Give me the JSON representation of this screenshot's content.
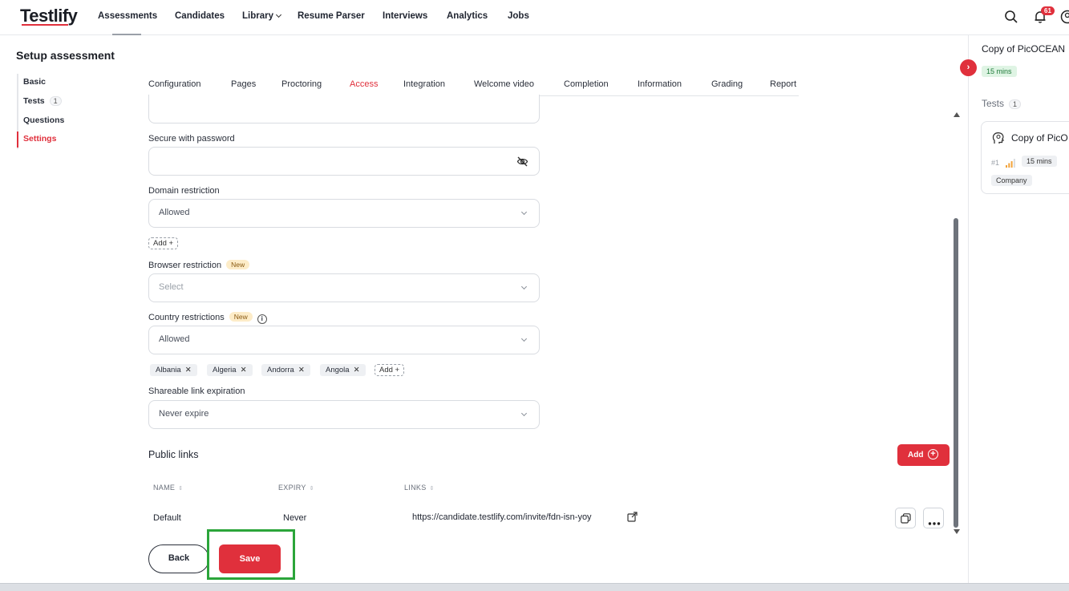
{
  "app": {
    "logo": "Testlify",
    "nav": [
      "Assessments",
      "Candidates",
      "Library",
      "Resume Parser",
      "Interviews",
      "Analytics",
      "Jobs"
    ],
    "notification_count": "61"
  },
  "sidebar": {
    "title": "Setup assessment",
    "items": [
      {
        "label": "Basic"
      },
      {
        "label": "Tests",
        "count": "1"
      },
      {
        "label": "Questions"
      },
      {
        "label": "Settings"
      }
    ]
  },
  "tabs": [
    "Configuration",
    "Pages",
    "Proctoring",
    "Access",
    "Integration",
    "Welcome video",
    "Completion",
    "Information",
    "Grading",
    "Report"
  ],
  "form": {
    "password_label": "Secure with password",
    "password_value": "",
    "domain_label": "Domain restriction",
    "domain_value": "Allowed",
    "add_label": "Add",
    "browser_label": "Browser restriction",
    "new_badge": "New",
    "browser_placeholder": "Select",
    "country_label": "Country restrictions",
    "country_value": "Allowed",
    "country_tags": [
      "Albania",
      "Algeria",
      "Andorra",
      "Angola"
    ],
    "expiration_label": "Shareable link expiration",
    "expiration_value": "Never expire"
  },
  "public_links": {
    "title": "Public links",
    "add_label": "Add",
    "columns": [
      "NAME",
      "EXPIRY",
      "LINKS"
    ],
    "rows": [
      {
        "name": "Default",
        "expiry": "Never",
        "link": "https://candidate.testlify.com/invite/fdn-isn-yoy"
      }
    ]
  },
  "footer": {
    "back_label": "Back",
    "save_label": "Save"
  },
  "right_panel": {
    "title": "Copy of PicOCEAN",
    "duration": "15 mins",
    "tests_label": "Tests",
    "tests_count": "1",
    "card": {
      "title": "Copy of PicO",
      "number": "#1",
      "duration": "15 mins",
      "tag": "Company"
    }
  },
  "colors": {
    "accent": "#e0303c",
    "highlight": "#2ba53a"
  }
}
